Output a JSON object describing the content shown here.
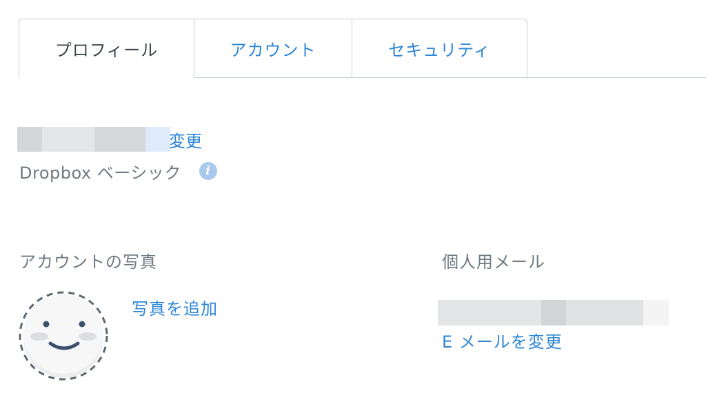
{
  "tabs": [
    {
      "label": "プロフィール",
      "active": true
    },
    {
      "label": "アカウント",
      "active": false
    },
    {
      "label": "セキュリティ",
      "active": false
    }
  ],
  "profile": {
    "name_redacted": true,
    "change_name_link": "変更",
    "plan_label": "Dropbox ベーシック",
    "plan_info_icon": "info-icon"
  },
  "photo": {
    "heading": "アカウントの写真",
    "add_photo_link": "写真を追加",
    "avatar_icon": "smiley-avatar-placeholder"
  },
  "email": {
    "heading": "個人用メール",
    "address_redacted": true,
    "change_email_link": "E メールを変更"
  },
  "colors": {
    "link": "#2d86d6",
    "muted_text": "#6f7982",
    "active_tab_text": "#3d464d",
    "border": "#c8ced6",
    "info_icon": "#a9c9ec",
    "redaction_gray": "#d4d6d9",
    "redaction_light": "#e9eaec",
    "redaction_blue": "#dfeafa"
  }
}
